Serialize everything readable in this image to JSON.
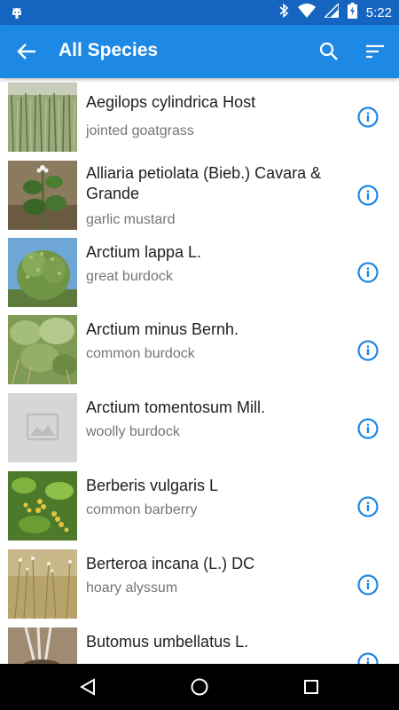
{
  "status_bar": {
    "time": "5:22"
  },
  "app_bar": {
    "title": "All Species"
  },
  "species": [
    {
      "name": "Aegilops cylindrica Host",
      "common": "jointed goatgrass"
    },
    {
      "name": "Alliaria petiolata (Bieb.) Cavara & Grande",
      "common": "garlic mustard"
    },
    {
      "name": "Arctium lappa L.",
      "common": "great burdock"
    },
    {
      "name": "Arctium minus Bernh.",
      "common": "common burdock"
    },
    {
      "name": "Arctium tomentosum Mill.",
      "common": "woolly burdock"
    },
    {
      "name": "Berberis vulgaris L",
      "common": "common barberry"
    },
    {
      "name": "Berteroa incana (L.) DC",
      "common": "hoary alyssum"
    },
    {
      "name": "Butomus umbellatus L.",
      "common": ""
    }
  ],
  "colors": {
    "status_bar": "#1565C0",
    "app_bar": "#1E88E5",
    "info_icon": "#1E88E5"
  }
}
